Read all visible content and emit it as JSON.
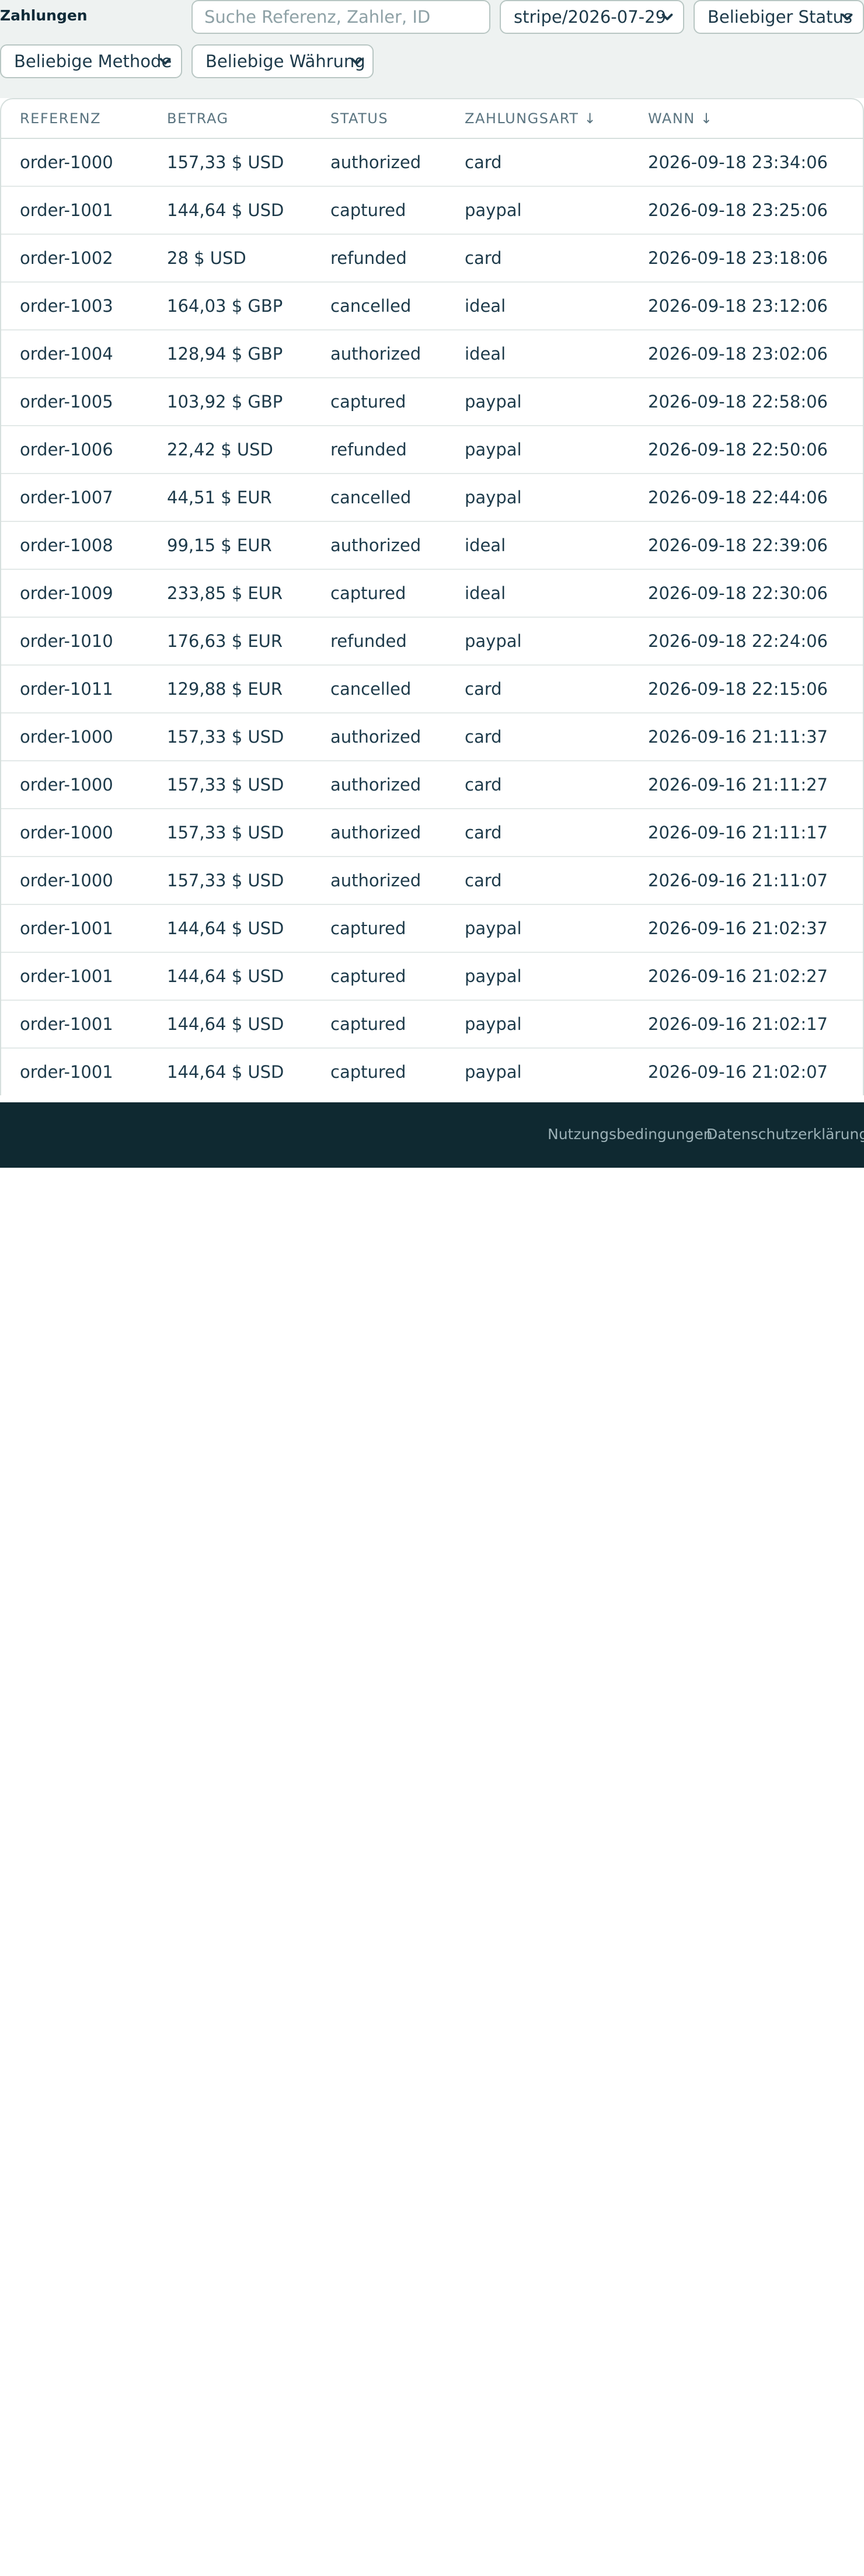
{
  "header": {
    "title": "Zahlungen",
    "search": {
      "placeholder": "Suche Referenz, Zahler, ID",
      "value": ""
    },
    "account_select": "stripe/2026-07-29",
    "status_select": "Beliebiger Status",
    "method_select": "Beliebige Methode",
    "currency_select": "Beliebige Währung"
  },
  "table": {
    "columns": [
      {
        "label": "REFERENZ"
      },
      {
        "label": "BETRAG"
      },
      {
        "label": "STATUS"
      },
      {
        "label": "ZAHLUNGSART ↓"
      },
      {
        "label": "WANN ↓"
      }
    ],
    "rows": [
      {
        "ref": "order-1000",
        "amount": "157,33 $ USD",
        "status": "authorized",
        "method": "card",
        "when": "2026-09-18 23:34:06"
      },
      {
        "ref": "order-1001",
        "amount": "144,64 $ USD",
        "status": "captured",
        "method": "paypal",
        "when": "2026-09-18 23:25:06"
      },
      {
        "ref": "order-1002",
        "amount": "28 $ USD",
        "status": "refunded",
        "method": "card",
        "when": "2026-09-18 23:18:06"
      },
      {
        "ref": "order-1003",
        "amount": "164,03 $ GBP",
        "status": "cancelled",
        "method": "ideal",
        "when": "2026-09-18 23:12:06"
      },
      {
        "ref": "order-1004",
        "amount": "128,94 $ GBP",
        "status": "authorized",
        "method": "ideal",
        "when": "2026-09-18 23:02:06"
      },
      {
        "ref": "order-1005",
        "amount": "103,92 $ GBP",
        "status": "captured",
        "method": "paypal",
        "when": "2026-09-18 22:58:06"
      },
      {
        "ref": "order-1006",
        "amount": "22,42 $ USD",
        "status": "refunded",
        "method": "paypal",
        "when": "2026-09-18 22:50:06"
      },
      {
        "ref": "order-1007",
        "amount": "44,51 $ EUR",
        "status": "cancelled",
        "method": "paypal",
        "when": "2026-09-18 22:44:06"
      },
      {
        "ref": "order-1008",
        "amount": "99,15 $ EUR",
        "status": "authorized",
        "method": "ideal",
        "when": "2026-09-18 22:39:06"
      },
      {
        "ref": "order-1009",
        "amount": "233,85 $ EUR",
        "status": "captured",
        "method": "ideal",
        "when": "2026-09-18 22:30:06"
      },
      {
        "ref": "order-1010",
        "amount": "176,63 $ EUR",
        "status": "refunded",
        "method": "paypal",
        "when": "2026-09-18 22:24:06"
      },
      {
        "ref": "order-1011",
        "amount": "129,88 $ EUR",
        "status": "cancelled",
        "method": "card",
        "when": "2026-09-18 22:15:06"
      },
      {
        "ref": "order-1000",
        "amount": "157,33 $ USD",
        "status": "authorized",
        "method": "card",
        "when": "2026-09-16 21:11:37"
      },
      {
        "ref": "order-1000",
        "amount": "157,33 $ USD",
        "status": "authorized",
        "method": "card",
        "when": "2026-09-16 21:11:27"
      },
      {
        "ref": "order-1000",
        "amount": "157,33 $ USD",
        "status": "authorized",
        "method": "card",
        "when": "2026-09-16 21:11:17"
      },
      {
        "ref": "order-1000",
        "amount": "157,33 $ USD",
        "status": "authorized",
        "method": "card",
        "when": "2026-09-16 21:11:07"
      },
      {
        "ref": "order-1001",
        "amount": "144,64 $ USD",
        "status": "captured",
        "method": "paypal",
        "when": "2026-09-16 21:02:37"
      },
      {
        "ref": "order-1001",
        "amount": "144,64 $ USD",
        "status": "captured",
        "method": "paypal",
        "when": "2026-09-16 21:02:27"
      },
      {
        "ref": "order-1001",
        "amount": "144,64 $ USD",
        "status": "captured",
        "method": "paypal",
        "when": "2026-09-16 21:02:17"
      },
      {
        "ref": "order-1001",
        "amount": "144,64 $ USD",
        "status": "captured",
        "method": "paypal",
        "when": "2026-09-16 21:02:07"
      }
    ]
  },
  "footer": {
    "terms": "Nutzungsbedingungen",
    "privacy": "Datenschutzerklärung"
  },
  "colors": {
    "page_bg": "#eef2f1",
    "text": "#1d3a4a",
    "footer_bg": "#0f2931"
  }
}
